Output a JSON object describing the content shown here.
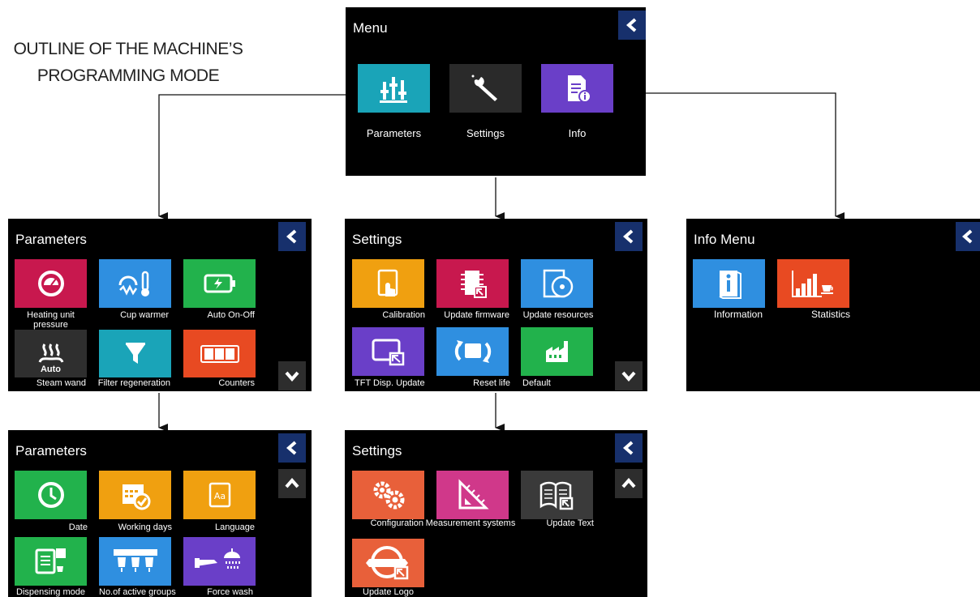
{
  "heading": {
    "line1": "OUTLINE OF THE MACHINE’S",
    "line2": "PROGRAMMING MODE"
  },
  "menu": {
    "title": "Menu",
    "items": [
      "Parameters",
      "Settings",
      "Info"
    ]
  },
  "parameters1": {
    "title": "Parameters",
    "items": [
      "Heating unit",
      "pressure",
      "Cup warmer",
      "Auto On-Off",
      "Steam wand",
      "Filter regeneration",
      "Counters",
      "Auto"
    ]
  },
  "settings1": {
    "title": "Settings",
    "items": [
      "Calibration",
      "Update firmware",
      "Update resources",
      "TFT Disp. Update",
      "Reset life",
      "Default"
    ]
  },
  "info_menu": {
    "title": "Info Menu",
    "items": [
      "Information",
      "Statistics"
    ]
  },
  "parameters2": {
    "title": "Parameters",
    "items": [
      "Date",
      "Working days",
      "Language",
      "Dispensing mode",
      "No.of active groups",
      "Force wash"
    ]
  },
  "settings2": {
    "title": "Settings",
    "items": [
      "Configuration",
      "Measurement systems",
      "Update Text",
      "Update Logo"
    ]
  },
  "icons": {
    "back": "chevron-left-icon",
    "scroll_down": "chevron-down-icon",
    "scroll_up": "chevron-up-icon"
  },
  "colors": {
    "screen_bg": "#000000",
    "back_button": "#17306c",
    "teal": "#1aa4b8",
    "purple": "#6a3fc8",
    "crimson": "#c8184e",
    "blue": "#2f8fe0",
    "green": "#22b24c",
    "orange": "#f0a010",
    "red_orange": "#e84a22",
    "magenta": "#d0388a"
  }
}
